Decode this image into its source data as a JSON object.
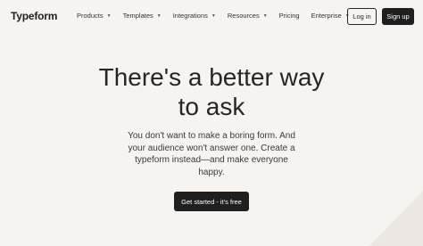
{
  "nav": {
    "logo": "Typeform",
    "menu": [
      {
        "label": "Products",
        "dropdown": true
      },
      {
        "label": "Templates",
        "dropdown": true
      },
      {
        "label": "Integrations",
        "dropdown": true
      },
      {
        "label": "Resources",
        "dropdown": true
      },
      {
        "label": "Pricing",
        "dropdown": false
      },
      {
        "label": "Enterprise",
        "dropdown": true
      }
    ],
    "login_label": "Log in",
    "signup_label": "Sign up"
  },
  "hero": {
    "title_line1": "There's a better way",
    "title_line2": "to ask",
    "subtitle": "You don't want to make a boring form. And your audience won't answer one. Create a typeform instead—and make everyone happy.",
    "cta_label": "Get started - it's free"
  },
  "colors": {
    "background": "#f6f3f0",
    "text": "#262627",
    "button_dark": "#1f1f20"
  }
}
